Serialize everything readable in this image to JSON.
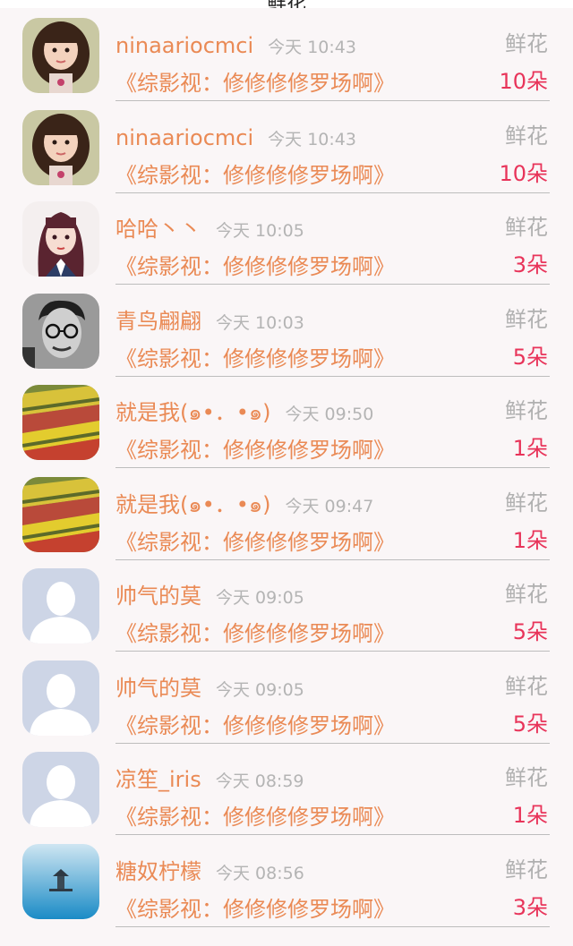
{
  "header": {
    "title": "鲜花"
  },
  "gift_label": "鲜花",
  "rows": [
    {
      "name": "ninaariocmci",
      "time": "今天 10:43",
      "source": "《综影视：修修修修罗场啊》",
      "count": "10朵",
      "avatar": "girl-photo"
    },
    {
      "name": "ninaariocmci",
      "time": "今天 10:43",
      "source": "《综影视：修修修修罗场啊》",
      "count": "10朵",
      "avatar": "girl-photo"
    },
    {
      "name": "哈哈丶丶",
      "time": "今天 10:05",
      "source": "《综影视：修修修修罗场啊》",
      "count": "3朵",
      "avatar": "anime-girl"
    },
    {
      "name": "青鸟翩翩",
      "time": "今天 10:03",
      "source": "《综影视：修修修修罗场啊》",
      "count": "5朵",
      "avatar": "man-glasses"
    },
    {
      "name": "就是我(๑•．•๑)",
      "time": "今天 09:50",
      "source": "《综影视：修修修修罗场啊》",
      "count": "1朵",
      "avatar": "flower-field"
    },
    {
      "name": "就是我(๑•．•๑)",
      "time": "今天 09:47",
      "source": "《综影视：修修修修罗场啊》",
      "count": "1朵",
      "avatar": "flower-field"
    },
    {
      "name": "帅气的莫",
      "time": "今天 09:05",
      "source": "《综影视：修修修修罗场啊》",
      "count": "5朵",
      "avatar": "default-person"
    },
    {
      "name": "帅气的莫",
      "time": "今天 09:05",
      "source": "《综影视：修修修修罗场啊》",
      "count": "5朵",
      "avatar": "default-person"
    },
    {
      "name": "凉笙_iris",
      "time": "今天 08:59",
      "source": "《综影视：修修修修罗场啊》",
      "count": "1朵",
      "avatar": "default-person"
    },
    {
      "name": "糖奴柠檬",
      "time": "今天 08:56",
      "source": "《综影视：修修修修罗场啊》",
      "count": "3朵",
      "avatar": "lake-pavilion"
    }
  ]
}
